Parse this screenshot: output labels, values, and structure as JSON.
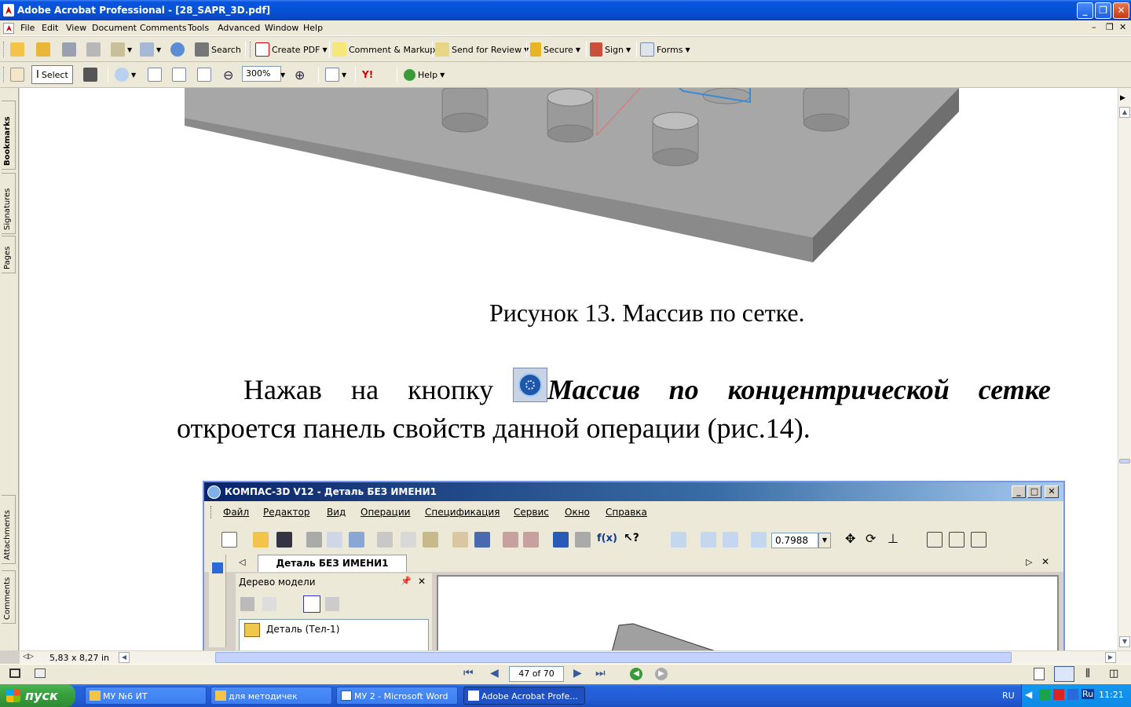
{
  "window": {
    "title": "Adobe Acrobat Professional - [28_SAPR_3D.pdf]"
  },
  "menubar": {
    "items": [
      "File",
      "Edit",
      "View",
      "Document",
      "Comments",
      "Tools",
      "Advanced",
      "Window",
      "Help"
    ]
  },
  "toolbar1": {
    "search_label": "Search",
    "create_pdf_label": "Create PDF",
    "comment_markup_label": "Comment & Markup",
    "send_review_label": "Send for Review",
    "secure_label": "Secure",
    "sign_label": "Sign",
    "forms_label": "Forms"
  },
  "toolbar2": {
    "select_label": "Select",
    "zoom_value": "300%",
    "help_label": "Help"
  },
  "navpane": {
    "tabs": [
      "Bookmarks",
      "Signatures",
      "Pages",
      "Attachments",
      "Comments"
    ]
  },
  "document": {
    "caption": "Рисунок 13. Массив по сетке.",
    "para_lead": "Нажав на кнопку",
    "para_bold": "Массив по концентрической сетке",
    "para_rest": "откроется панель свойств данной операции (рис.14)."
  },
  "kompas": {
    "title": "КОМПАС-3D V12 - Деталь БЕЗ ИМЕНИ1",
    "menu": [
      "Файл",
      "Редактор",
      "Вид",
      "Операции",
      "Спецификация",
      "Сервис",
      "Окно",
      "Справка"
    ],
    "zoom_value": "0.7988",
    "tab_label": "Деталь БЕЗ ИМЕНИ1",
    "tree_title": "Дерево модели",
    "tree_item": "Деталь (Тел-1)"
  },
  "statusbar": {
    "page_size": "5,83 x 8,27 in",
    "page_indicator": "47 of 70"
  },
  "taskbar": {
    "start_label": "пуск",
    "tasks": [
      "МУ №6 ИТ",
      "для методичек",
      "МУ 2 - Microsoft Word",
      "Adobe Acrobat Profe..."
    ],
    "lang": "RU",
    "lang2": "Ru",
    "clock": "11:21"
  },
  "colors": {
    "titlebar": "#0453d6",
    "taskbar": "#245ed6",
    "start": "#38a33e",
    "model_gray": "#a0a0a0"
  }
}
